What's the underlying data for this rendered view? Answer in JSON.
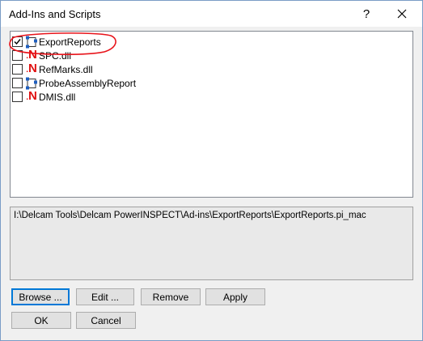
{
  "window": {
    "title": "Add-Ins and Scripts"
  },
  "titlebar": {
    "help_label": "?"
  },
  "addins": [
    {
      "label": "ExportReports",
      "checked": true,
      "icon": "macro-script-icon"
    },
    {
      "label": "SPC.dll",
      "checked": false,
      "icon": "dotnet-dll-icon"
    },
    {
      "label": "RefMarks.dll",
      "checked": false,
      "icon": "dotnet-dll-icon"
    },
    {
      "label": "ProbeAssemblyReport",
      "checked": false,
      "icon": "macro-script-icon"
    },
    {
      "label": "DMIS.dll",
      "checked": false,
      "icon": "dotnet-dll-icon"
    }
  ],
  "icon_glyphs": {
    "dotnet_letter": "N",
    "dotnet_dot": "."
  },
  "path": "I:\\Delcam Tools\\Delcam PowerINSPECT\\Ad-ins\\ExportReports\\ExportReports.pi_mac",
  "buttons": {
    "browse": "Browse ...",
    "edit": "Edit ...",
    "remove": "Remove",
    "apply": "Apply",
    "ok": "OK",
    "cancel": "Cancel"
  },
  "colors": {
    "accent": "#0078d7",
    "dll_icon": "#e01010",
    "annotation": "#e8141b"
  }
}
